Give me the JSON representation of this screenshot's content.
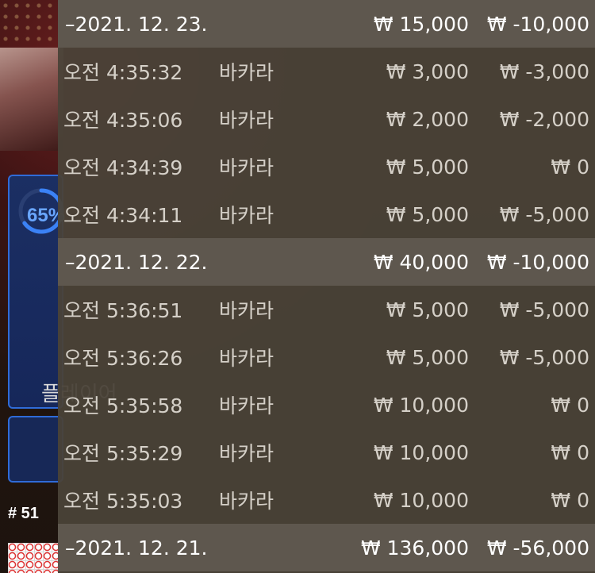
{
  "background": {
    "progress": {
      "percent": 65,
      "label": "65%"
    },
    "player_label": "플레이어",
    "round_label": "# 51"
  },
  "history": [
    {
      "date": "–2021. 12. 23.",
      "bet_total": "₩ 15,000",
      "result_total": "₩ -10,000",
      "rows": [
        {
          "time": "오전 4:35:32",
          "game": "바카라",
          "bet": "₩ 3,000",
          "result": "₩ -3,000"
        },
        {
          "time": "오전 4:35:06",
          "game": "바카라",
          "bet": "₩ 2,000",
          "result": "₩ -2,000"
        },
        {
          "time": "오전 4:34:39",
          "game": "바카라",
          "bet": "₩ 5,000",
          "result": "₩ 0"
        },
        {
          "time": "오전 4:34:11",
          "game": "바카라",
          "bet": "₩ 5,000",
          "result": "₩ -5,000"
        }
      ]
    },
    {
      "date": "–2021. 12. 22.",
      "bet_total": "₩ 40,000",
      "result_total": "₩ -10,000",
      "rows": [
        {
          "time": "오전 5:36:51",
          "game": "바카라",
          "bet": "₩ 5,000",
          "result": "₩ -5,000"
        },
        {
          "time": "오전 5:36:26",
          "game": "바카라",
          "bet": "₩ 5,000",
          "result": "₩ -5,000"
        },
        {
          "time": "오전 5:35:58",
          "game": "바카라",
          "bet": "₩ 10,000",
          "result": "₩ 0"
        },
        {
          "time": "오전 5:35:29",
          "game": "바카라",
          "bet": "₩ 10,000",
          "result": "₩ 0"
        },
        {
          "time": "오전 5:35:03",
          "game": "바카라",
          "bet": "₩ 10,000",
          "result": "₩ 0"
        }
      ]
    },
    {
      "date": "–2021. 12. 21.",
      "bet_total": "₩ 136,000",
      "result_total": "₩ -56,000",
      "rows": []
    }
  ],
  "colors": {
    "overlay": "#4a4238",
    "date_header": "#5e574e",
    "accent_blue": "#2f6bd8"
  }
}
